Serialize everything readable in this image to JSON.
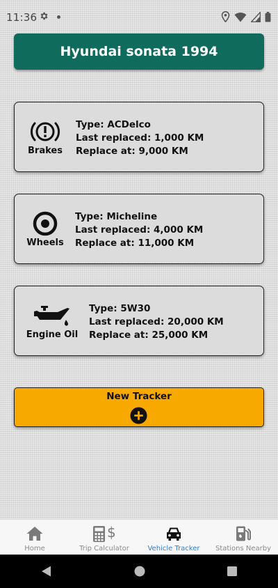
{
  "status_bar": {
    "time": "11:36"
  },
  "header": {
    "title": "Hyundai sonata 1994"
  },
  "trackers": [
    {
      "label": "Brakes",
      "icon": "brake-warning-icon",
      "type": "Type: ACDelco",
      "last_replaced": "Last replaced: 1,000 KM",
      "replace_at": "Replace at: 9,000 KM"
    },
    {
      "label": "Wheels",
      "icon": "wheel-icon",
      "type": "Type: Micheline",
      "last_replaced": "Last replaced: 4,000 KM",
      "replace_at": "Replace at: 11,000 KM"
    },
    {
      "label": "Engine Oil",
      "icon": "oil-can-icon",
      "type": "Type: 5W30",
      "last_replaced": "Last replaced: 20,000 KM",
      "replace_at": "Replace at: 25,000 KM"
    }
  ],
  "new_tracker": {
    "label": "New Tracker"
  },
  "bottom_nav": {
    "items": [
      {
        "label": "Home",
        "icon": "home-icon",
        "active": false
      },
      {
        "label": "Trip Calculator",
        "icon": "calculator-dollar-icon",
        "active": false
      },
      {
        "label": "Vehicle Tracker",
        "icon": "car-icon",
        "active": true
      },
      {
        "label": "Stations Nearby",
        "icon": "gas-station-icon",
        "active": false
      }
    ]
  },
  "colors": {
    "header_bg": "#0f6b5c",
    "button_bg": "#f7a900",
    "card_bg": "#dcdcdc",
    "active_nav": "#2a7ed8"
  }
}
